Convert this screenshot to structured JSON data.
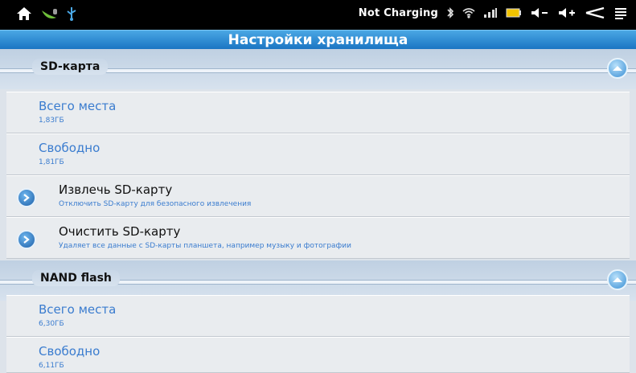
{
  "status": {
    "charging_text": "Not Charging",
    "icons_left": [
      "home-icon",
      "android-debug-icon",
      "usb-icon"
    ],
    "icons_right": [
      "bluetooth-icon",
      "wifi-icon",
      "signal-icon",
      "battery-icon",
      "volume-down-icon",
      "volume-up-icon",
      "back-icon",
      "menu-icon"
    ]
  },
  "title": "Настройки хранилища",
  "sections": [
    {
      "header": "SD-карта",
      "items": [
        {
          "title": "Всего места",
          "subtitle": "1,83ГБ"
        },
        {
          "title": "Свободно",
          "subtitle": "1,81ГБ"
        },
        {
          "title": "Извлечь SD-карту",
          "subtitle": "Отключить SD-карту для безопасного извлечения"
        },
        {
          "title": "Очистить SD-карту",
          "subtitle": "Удаляет все данные с SD-карты планшета, например музыку и фотографии"
        }
      ]
    },
    {
      "header": "NAND flash",
      "items": [
        {
          "title": "Всего места",
          "subtitle": "6,30ГБ"
        },
        {
          "title": "Свободно",
          "subtitle": "6,11ГБ"
        }
      ]
    }
  ],
  "colors": {
    "title_bar": "#2a8fda",
    "link_text": "#3a7ccf",
    "status_bar": "#000000"
  }
}
